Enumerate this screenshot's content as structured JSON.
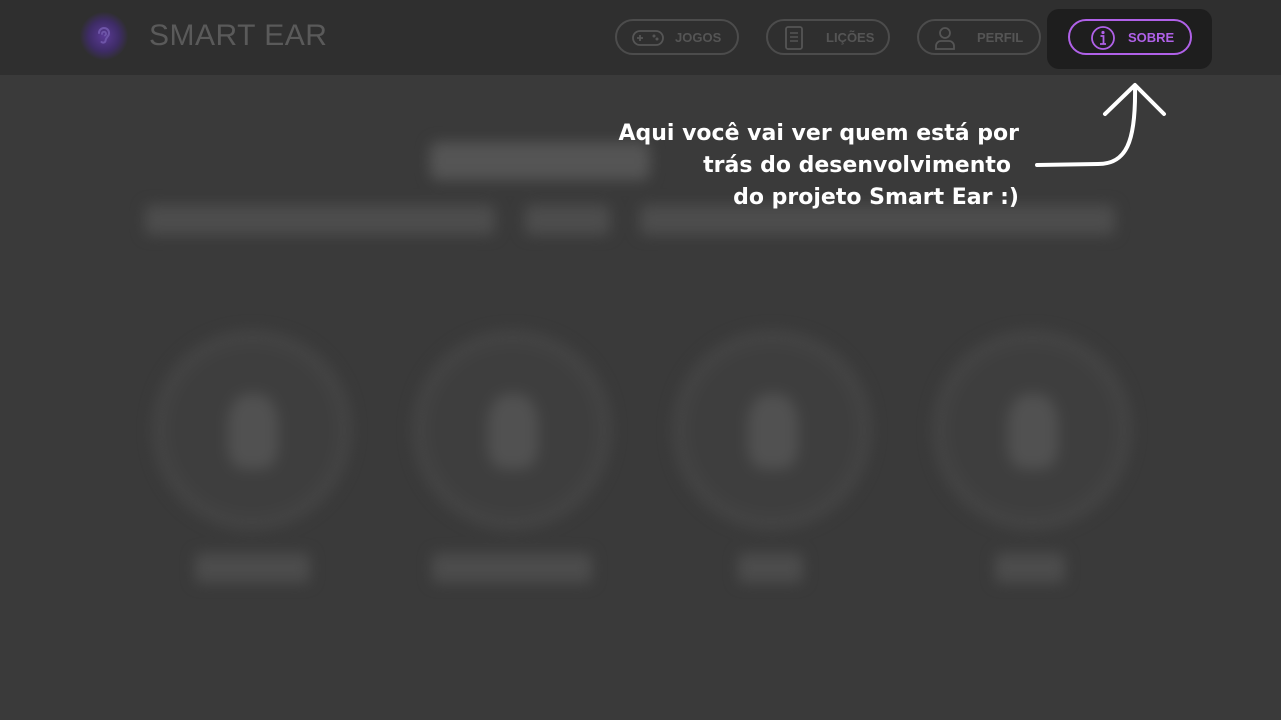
{
  "app": {
    "title": "SMART EAR",
    "logo_icon": "ear-icon"
  },
  "nav": {
    "items": [
      {
        "label": "JOGOS",
        "icon": "gamepad-icon",
        "active": false
      },
      {
        "label": "LIÇÕES",
        "icon": "document-icon",
        "active": false
      },
      {
        "label": "PERFIL",
        "icon": "user-icon",
        "active": false
      },
      {
        "label": "SOBRE",
        "icon": "info-icon",
        "active": true
      }
    ]
  },
  "tooltip": {
    "lines": [
      "Aqui você vai ver quem está por",
      "trás do desenvolvimento",
      "do projeto Smart Ear :)"
    ],
    "arrow_icon": "curved-arrow-icon"
  },
  "colors": {
    "accent": "#b061e8",
    "overlay_bg": "#3a3a3a",
    "header_bg": "#2f2f2f",
    "tooltip_text": "#ffffff"
  }
}
